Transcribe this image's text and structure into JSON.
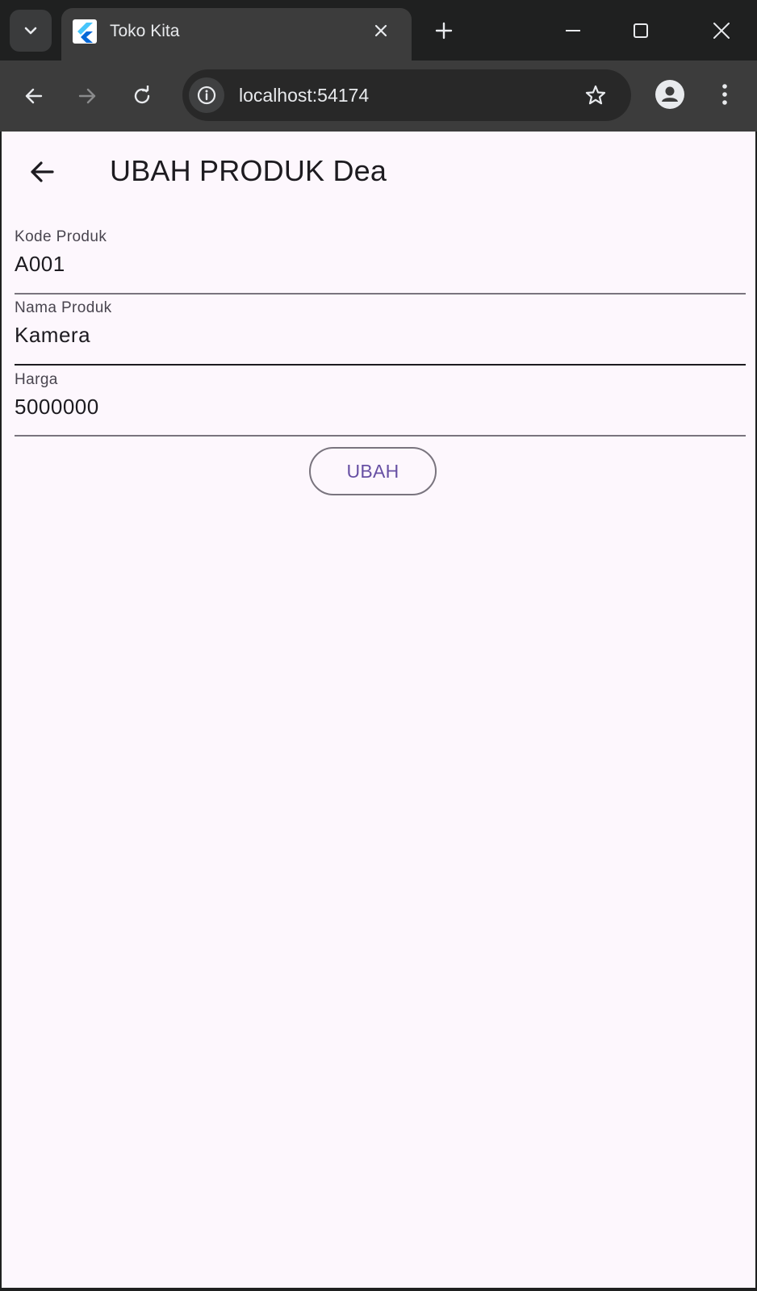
{
  "browser": {
    "tab_title": "Toko Kita",
    "url": "localhost:54174"
  },
  "page": {
    "title": "UBAH PRODUK Dea",
    "fields": [
      {
        "label": "Kode Produk",
        "value": "A001"
      },
      {
        "label": "Nama Produk",
        "value": "Kamera"
      },
      {
        "label": "Harga",
        "value": "5000000"
      }
    ],
    "submit_label": "UBAH"
  },
  "colors": {
    "background": "#fdf7fd",
    "accent": "#6750a4",
    "outline": "#79747e"
  }
}
